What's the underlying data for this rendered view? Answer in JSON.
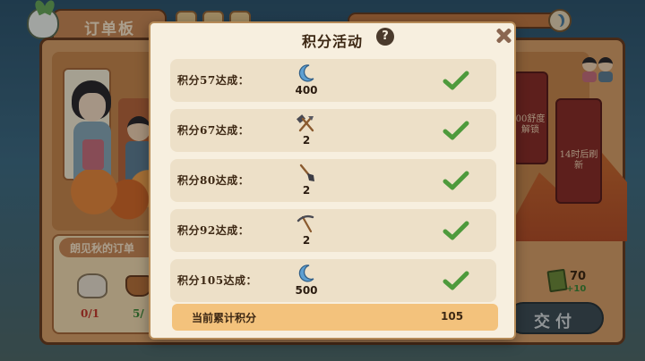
{
  "background": {
    "board_tab_title": "订单板",
    "order_panel_title": "朗见秋的订单",
    "item_counts": [
      "0/1",
      "5/"
    ],
    "right_card_1_text": "00舒度解锁",
    "right_card_2_text": "14时后刷新",
    "reward_value": "70",
    "reward_bonus": "+10",
    "deliver_button": "交付"
  },
  "modal": {
    "title": "积分活动",
    "help_label": "?",
    "rows": [
      {
        "label": "积分57达成：",
        "icon": "moon-currency-icon",
        "qty": "400",
        "status": "completed"
      },
      {
        "label": "积分67达成：",
        "icon": "hammer-axe-tools-icon",
        "qty": "2",
        "status": "completed"
      },
      {
        "label": "积分80达成：",
        "icon": "shovel-icon",
        "qty": "2",
        "status": "completed"
      },
      {
        "label": "积分92达成：",
        "icon": "pickaxe-icon",
        "qty": "2",
        "status": "completed"
      },
      {
        "label": "积分105达成：",
        "icon": "moon-currency-icon",
        "qty": "500",
        "status": "completed"
      }
    ],
    "total_label": "当前累计积分",
    "total_value": "105"
  },
  "colors": {
    "check_green": "#4e9a3c",
    "moon_blue": "#5d9fd1",
    "row_bg": "#ede0c8",
    "total_bar": "#f3c27c"
  }
}
